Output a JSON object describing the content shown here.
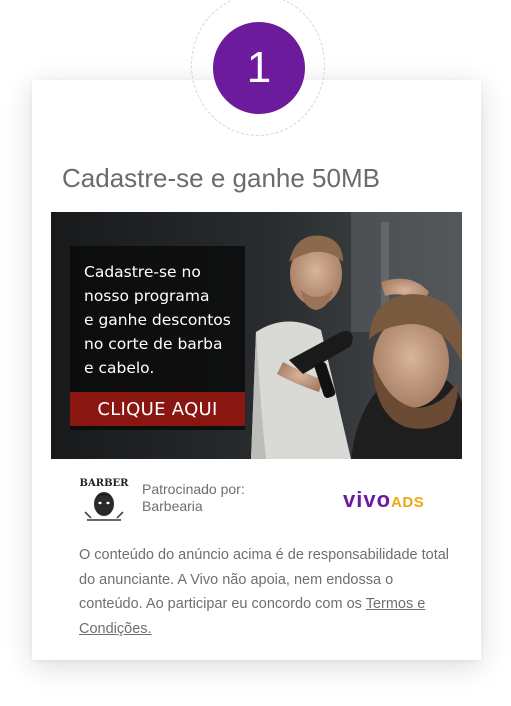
{
  "step": {
    "number": "1",
    "badge_color": "#6c1b9c"
  },
  "card": {
    "title": "Cadastre-se e ganhe 50MB"
  },
  "ad": {
    "copy": "Cadastre-se no\nnosso programa\ne ganhe descontos\nno corte de barba\ne cabelo.",
    "cta_label": "CLIQUE AQUI",
    "cta_color": "#8a1612",
    "image": "barber-cutting-hair-photo"
  },
  "sponsor": {
    "logo_icon": "barber-logo-icon",
    "logo_text": "BARBER",
    "label": "Patrocinado por:",
    "name": "Barbearia"
  },
  "network": {
    "brand": "vivo",
    "suffix": "ADS",
    "brand_color": "#6c1b9c",
    "suffix_color": "#f2a413"
  },
  "disclaimer": {
    "text": "O conteúdo do anúncio acima é de responsabilidade total do anunciante. A Vivo não apoia, nem endossa o conteúdo. Ao participar eu concordo com os",
    "link_label": "Termos e Condições."
  }
}
